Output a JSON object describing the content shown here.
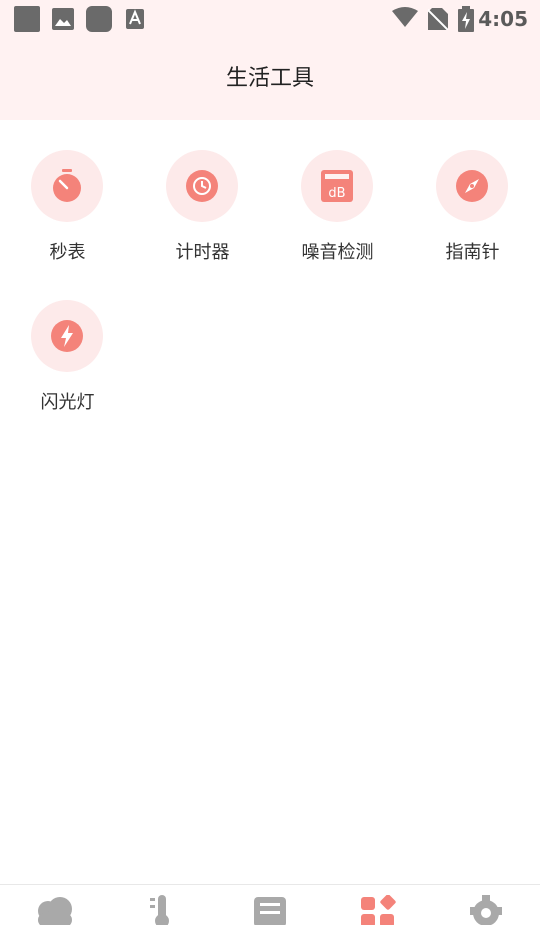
{
  "status_bar": {
    "time": "4:05",
    "left_icons": [
      "app-square-icon",
      "image-icon",
      "app-rounded-icon",
      "font-a-icon"
    ],
    "right_icons": [
      "wifi-icon",
      "no-sim-icon",
      "battery-charging-icon"
    ]
  },
  "header": {
    "title": "生活工具"
  },
  "tools": [
    {
      "label": "秒表",
      "icon": "stopwatch-icon"
    },
    {
      "label": "计时器",
      "icon": "timer-icon"
    },
    {
      "label": "噪音检测",
      "icon": "decibel-icon"
    },
    {
      "label": "指南针",
      "icon": "compass-icon"
    },
    {
      "label": "闪光灯",
      "icon": "flash-icon"
    }
  ],
  "bottom_nav": {
    "items": [
      {
        "icon": "weather-cloud-icon"
      },
      {
        "icon": "thermometer-icon"
      },
      {
        "icon": "clipboard-icon"
      },
      {
        "icon": "tools-grid-icon",
        "active": true
      },
      {
        "icon": "gear-icon"
      }
    ]
  },
  "colors": {
    "accent": "#f4837a",
    "icon_bg": "#fdeaea",
    "header_bg": "#fff2f2",
    "nav_inactive": "#a9a9a9"
  }
}
